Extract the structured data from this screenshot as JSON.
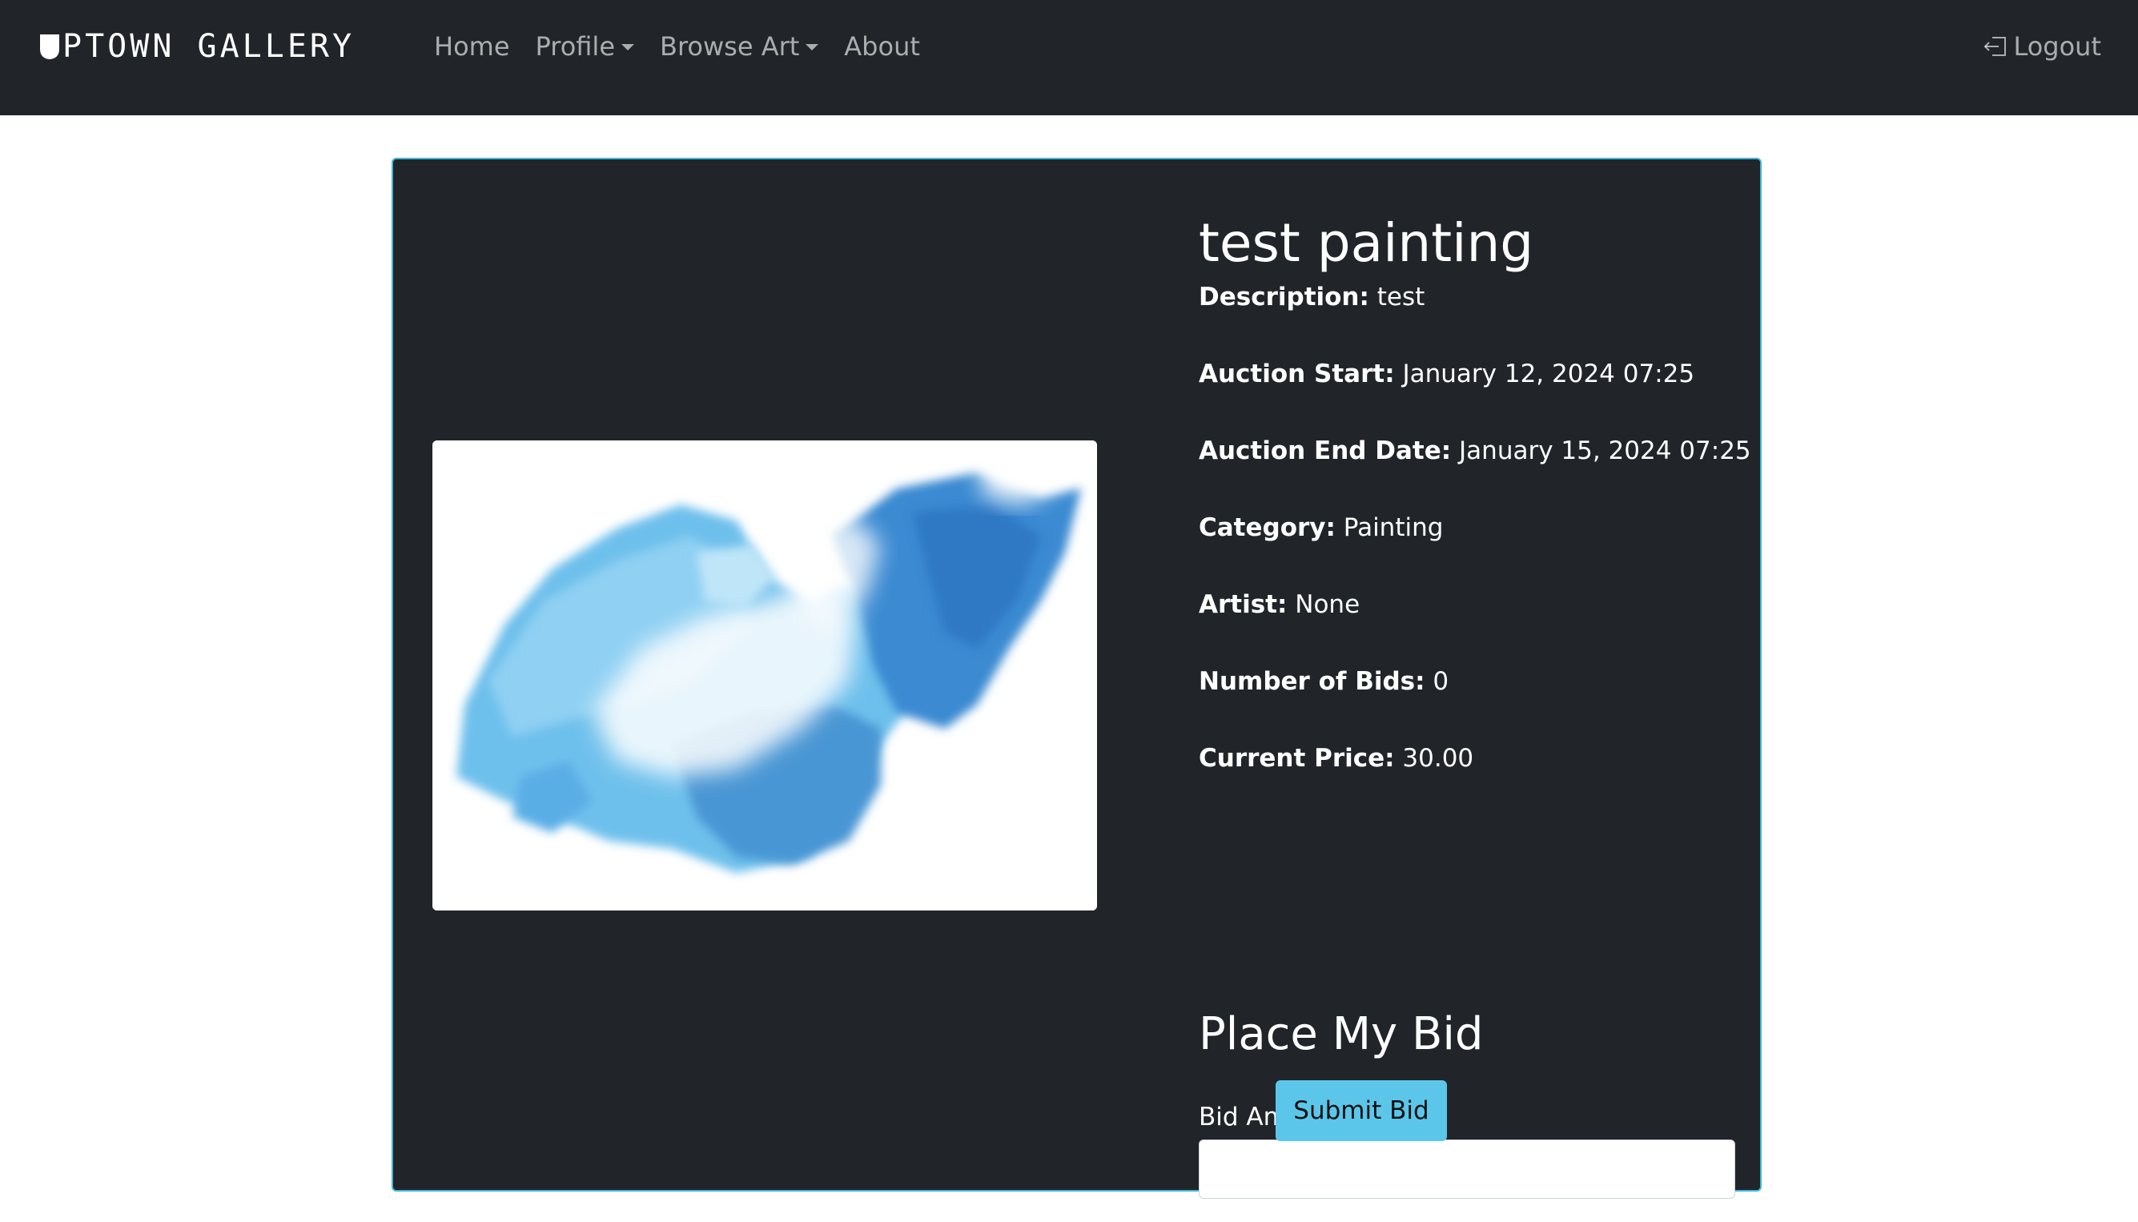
{
  "navbar": {
    "brand": "PTOWN GALLERY",
    "links": {
      "home": "Home",
      "profile": "Profile",
      "browse_art": "Browse Art",
      "about": "About"
    },
    "logout": "Logout"
  },
  "artwork": {
    "title": "test painting",
    "image_icon": "abstract-blue-painting",
    "description_label": "Description:",
    "description": "test",
    "auction_start_label": "Auction Start:",
    "auction_start": "January 12, 2024 07:25",
    "auction_end_label": "Auction End Date:",
    "auction_end": "January 15, 2024 07:25",
    "category_label": "Category:",
    "category": "Painting",
    "artist_label": "Artist:",
    "artist": "None",
    "bids_label": "Number of Bids:",
    "bids": "0",
    "price_label": "Current Price:",
    "price": "30.00"
  },
  "bid_form": {
    "heading": "Place My Bid",
    "amount_label": "Bid Amount:",
    "amount_value": "",
    "submit_label": "Submit Bid"
  },
  "colors": {
    "navbar_bg": "#212529",
    "card_bg": "#212529",
    "card_border": "#3fb6d6",
    "button_bg": "#5bc6ea"
  }
}
